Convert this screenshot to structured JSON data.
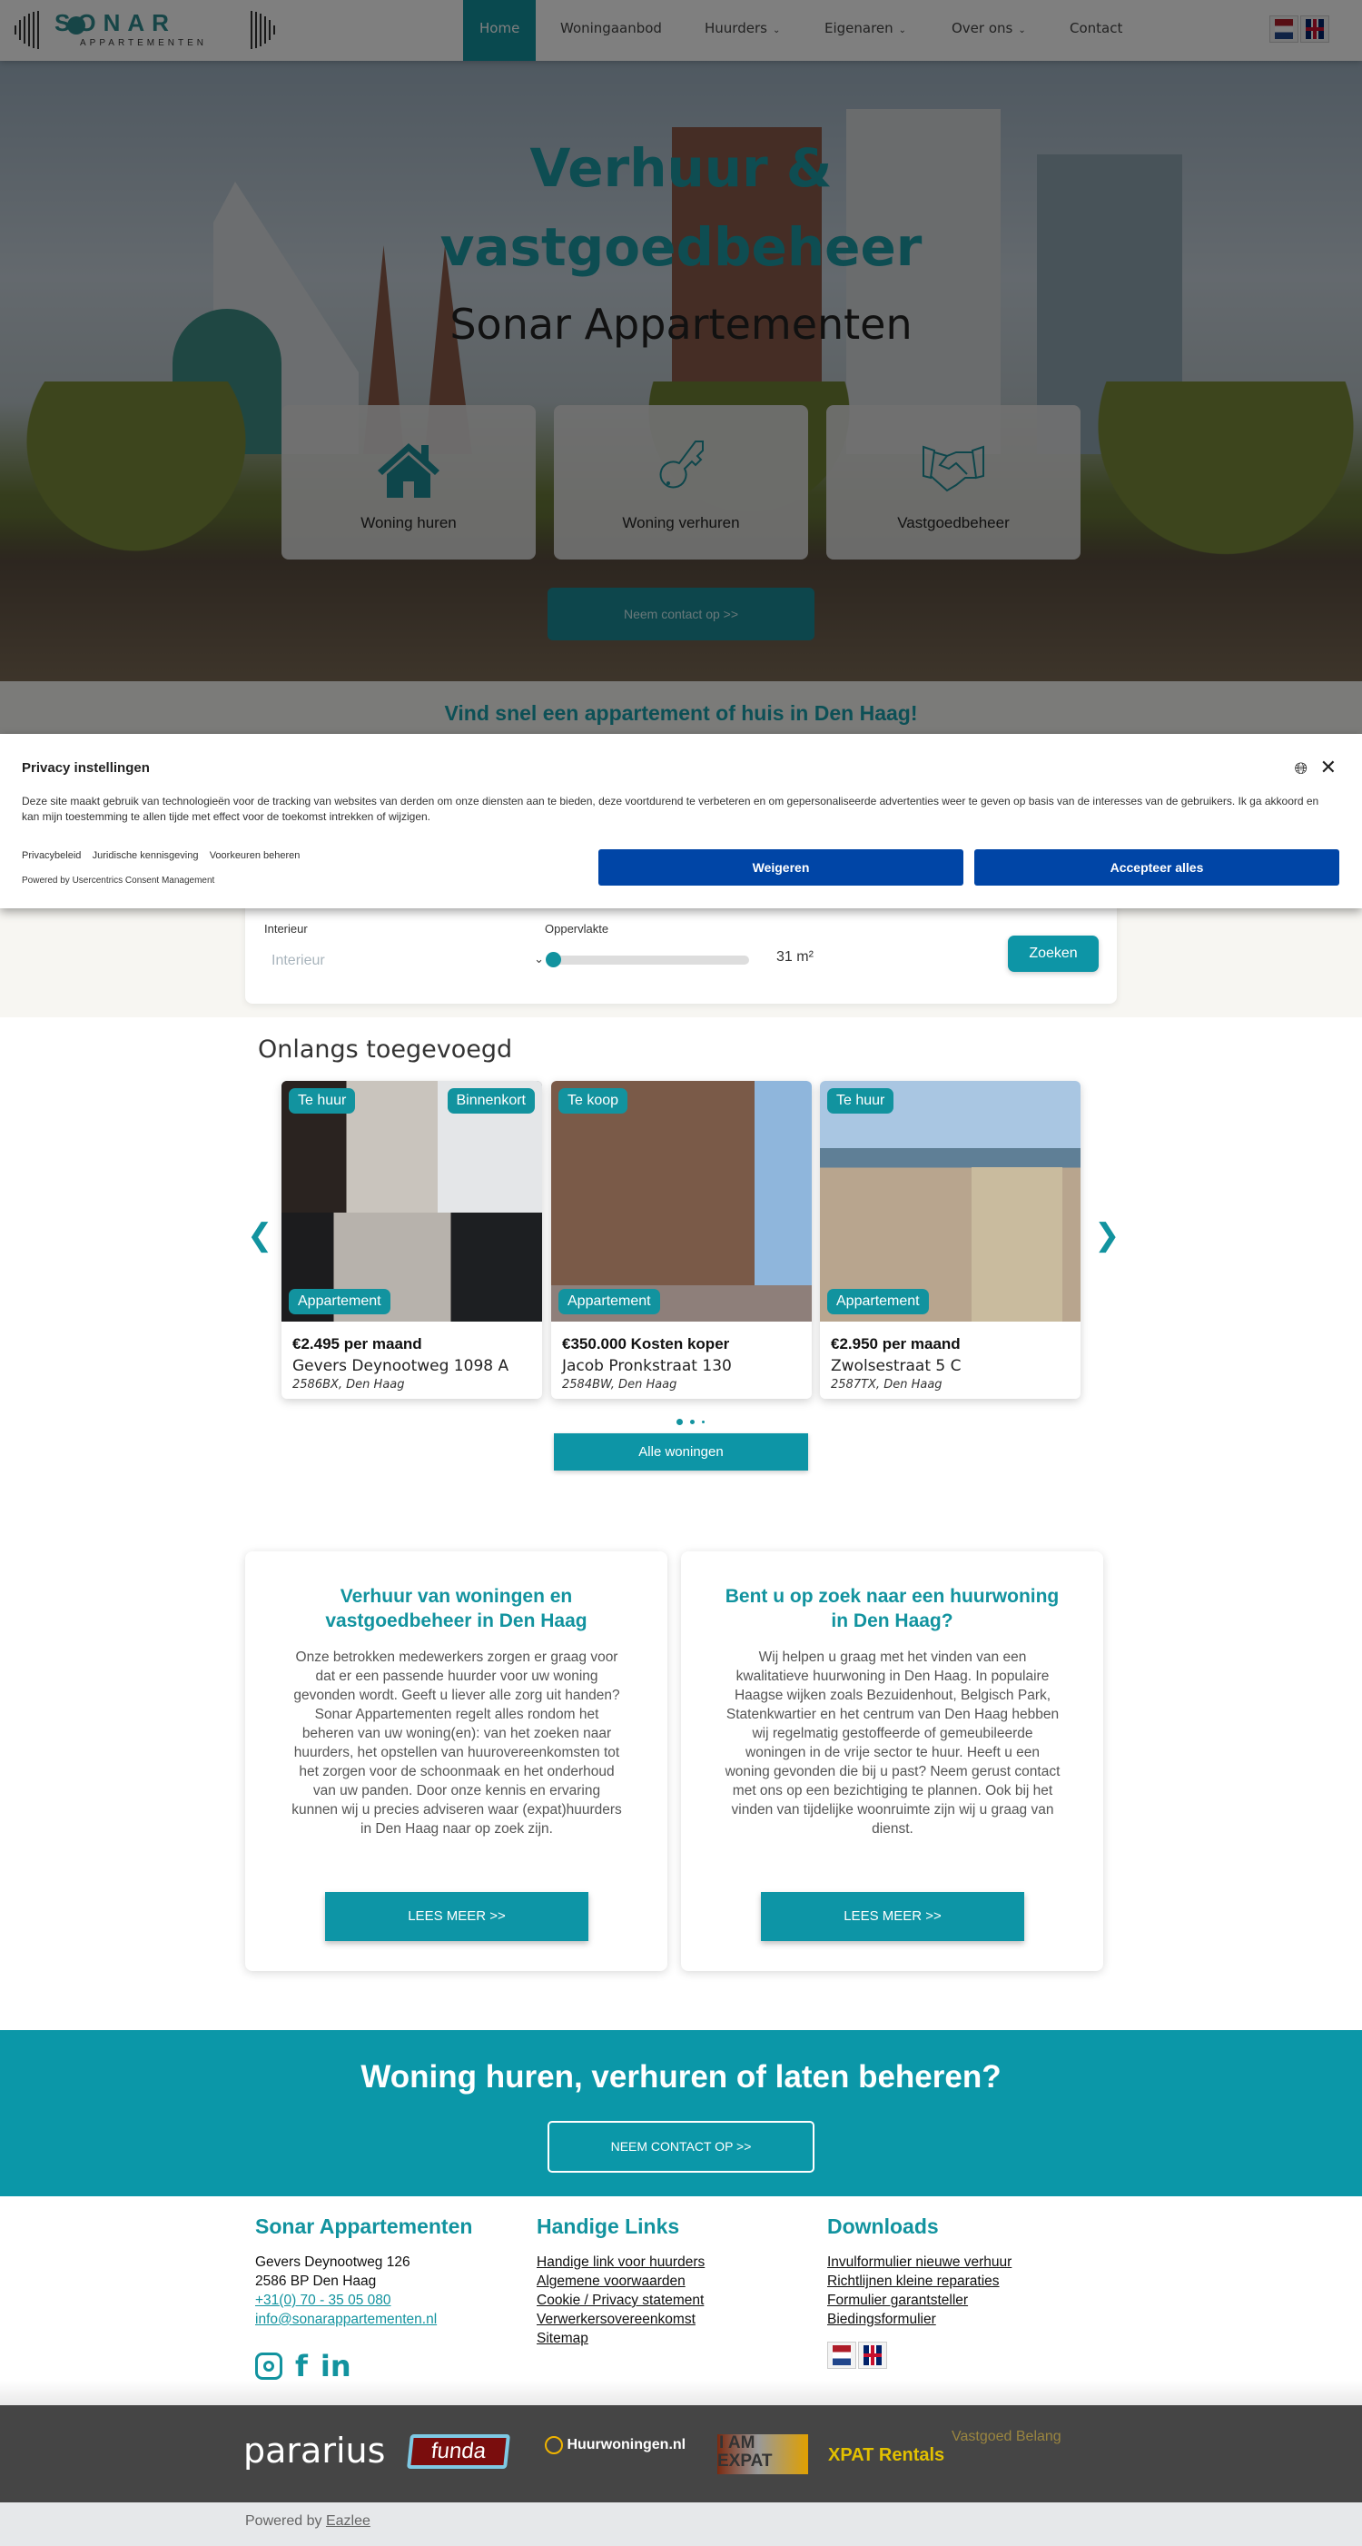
{
  "header": {
    "logo_text": "SONAR",
    "logo_sub": "APPARTEMENTEN",
    "nav": [
      {
        "label": "Home",
        "active": true
      },
      {
        "label": "Woningaanbod"
      },
      {
        "label": "Huurders",
        "dropdown": true
      },
      {
        "label": "Eigenaren",
        "dropdown": true
      },
      {
        "label": "Over ons",
        "dropdown": true
      },
      {
        "label": "Contact"
      }
    ],
    "languages": [
      "nl-flag",
      "uk-flag"
    ]
  },
  "hero": {
    "title_line1": "Verhuur &",
    "title_line2": "vastgoedbeheer",
    "subtitle": "Sonar Appartementen",
    "cards": [
      {
        "label": "Woning huren",
        "icon": "house-icon"
      },
      {
        "label": "Woning verhuren",
        "icon": "key-icon"
      },
      {
        "label": "Vastgoedbeheer",
        "icon": "handshake-icon"
      }
    ],
    "contact_button": "Neem contact op >>"
  },
  "search": {
    "title": "Vind snel een appartement of huis in Den Haag!",
    "interior_label": "Interieur",
    "interior_placeholder": "Interieur",
    "area_label": "Oppervlakte",
    "area_value": "31 m²",
    "area_slider_fraction": 0.0,
    "search_button": "Zoeken"
  },
  "privacy": {
    "title": "Privacy instellingen",
    "text": "Deze site maakt gebruik van technologieën voor de tracking van websites van derden om onze diensten aan te bieden, deze voortdurend te verbeteren en om gepersonaliseerde advertenties weer te geven op basis van de interesses van de gebruikers. Ik ga akkoord en kan mijn toestemming te allen tijde met effect voor de toekomst intrekken of wijzigen.",
    "links": [
      "Privacybeleid",
      "Juridische kennisgeving",
      "Voorkeuren beheren"
    ],
    "powered": "Powered by Usercentrics Consent Management",
    "reject": "Weigeren",
    "accept": "Accepteer alles"
  },
  "recent": {
    "title": "Onlangs toegevoegd",
    "listings": [
      {
        "status": "Te huur",
        "extra": "Binnenkort",
        "type": "Appartement",
        "price": "€2.495 per maand",
        "street": "Gevers Deynootweg 1098 A",
        "postcode": "2586BX, Den Haag"
      },
      {
        "status": "Te koop",
        "type": "Appartement",
        "price": "€350.000 Kosten koper",
        "street": "Jacob Pronkstraat 130",
        "postcode": "2584BW, Den Haag"
      },
      {
        "status": "Te huur",
        "type": "Appartement",
        "price": "€2.950 per maand",
        "street": "Zwolsestraat 5 C",
        "postcode": "2587TX, Den Haag"
      }
    ],
    "all_button": "Alle woningen",
    "active_dot": 1,
    "dot_count": 3
  },
  "info": [
    {
      "title": "Verhuur van woningen en vastgoedbeheer in Den Haag",
      "text": "Onze betrokken medewerkers zorgen er graag voor dat er een passende huurder voor uw woning gevonden wordt. Geeft u liever alle zorg uit handen? Sonar Appartementen regelt alles rondom het beheren van uw woning(en): van het zoeken naar huurders, het opstellen van huurovereenkomsten tot het zorgen voor de schoonmaak en het onderhoud van uw panden. Door onze kennis en ervaring kunnen wij u precies adviseren waar (expat)huurders in Den Haag naar op zoek zijn.",
      "button": "LEES MEER >>"
    },
    {
      "title": "Bent u op zoek naar een huurwoning in Den Haag?",
      "text": "Wij helpen u graag met het vinden van een kwalitatieve huurwoning in Den Haag. In populaire Haagse wijken zoals Bezuidenhout, Belgisch Park, Statenkwartier en het centrum van Den Haag hebben wij regelmatig gestoffeerde of gemeubileerde woningen in de vrije sector te huur. Heeft u een woning gevonden die bij u past? Neem gerust contact met ons op een bezichtiging te plannen. Ook bij het vinden van tijdelijke woonruimte zijn wij u graag van dienst.",
      "button": "LEES MEER >>"
    }
  ],
  "cta": {
    "title": "Woning huren, verhuren of laten beheren?",
    "button": "NEEM CONTACT OP >>"
  },
  "footer": {
    "company": {
      "title": "Sonar Appartementen",
      "address1": "Gevers Deynootweg 126",
      "address2": "2586 BP  Den Haag",
      "phone": "+31(0) 70 - 35 05 080",
      "email": "info@sonarappartementen.nl",
      "social": [
        "instagram-icon",
        "facebook-icon",
        "linkedin-icon"
      ]
    },
    "links": {
      "title": "Handige Links",
      "items": [
        "Handige link voor huurders",
        "Algemene voorwaarden",
        "Cookie / Privacy statement",
        "Verwerkersovereenkomst",
        "Sitemap"
      ]
    },
    "downloads": {
      "title": "Downloads",
      "items": [
        "Invulformulier nieuwe verhuur",
        "Richtlijnen kleine reparaties",
        "Formulier garantsteller",
        "Biedingsformulier"
      ]
    }
  },
  "partners": [
    "pararius",
    "funda",
    "Huurwoningen.nl",
    "I AM EXPAT",
    "XPAT Rentals",
    "Vastgoed Belang"
  ],
  "powered": {
    "prefix": "Powered by",
    "link": "Eazlee"
  },
  "colors": {
    "brand_teal": "#0d95a6",
    "privacy_blue": "#0045a6",
    "footer_dark": "#454545"
  }
}
